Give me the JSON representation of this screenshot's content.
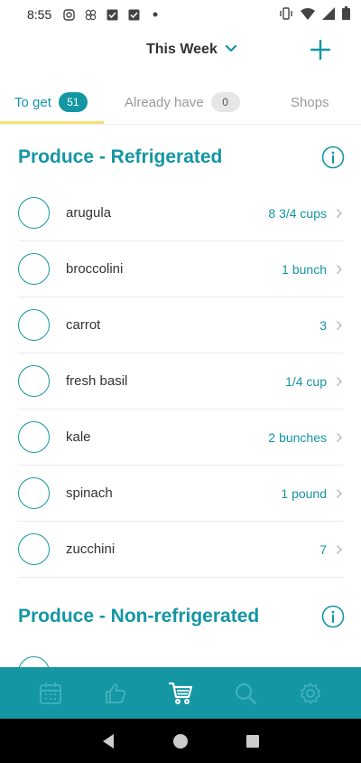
{
  "status_bar": {
    "time": "8:55"
  },
  "header": {
    "week_label": "This Week"
  },
  "tabs": {
    "to_get": {
      "label": "To get",
      "count": "51"
    },
    "already_have": {
      "label": "Already have",
      "count": "0"
    },
    "shops": {
      "label": "Shops"
    }
  },
  "sections": [
    {
      "title": "Produce - Refrigerated",
      "items": [
        {
          "name": "arugula",
          "qty": "8 3/4 cups"
        },
        {
          "name": "broccolini",
          "qty": "1 bunch"
        },
        {
          "name": "carrot",
          "qty": "3"
        },
        {
          "name": "fresh basil",
          "qty": "1/4 cup"
        },
        {
          "name": "kale",
          "qty": "2 bunches"
        },
        {
          "name": "spinach",
          "qty": "1 pound"
        },
        {
          "name": "zucchini",
          "qty": "7"
        }
      ]
    },
    {
      "title": "Produce - Non-refrigerated",
      "items": []
    }
  ],
  "bottom_nav": [
    "calendar-icon",
    "thumbs-up-icon",
    "cart-icon",
    "search-icon",
    "settings-icon"
  ],
  "colors": {
    "accent": "#1496a3",
    "tab_underline": "#f2e07b",
    "nav_inactive": "#3fb0bb"
  }
}
